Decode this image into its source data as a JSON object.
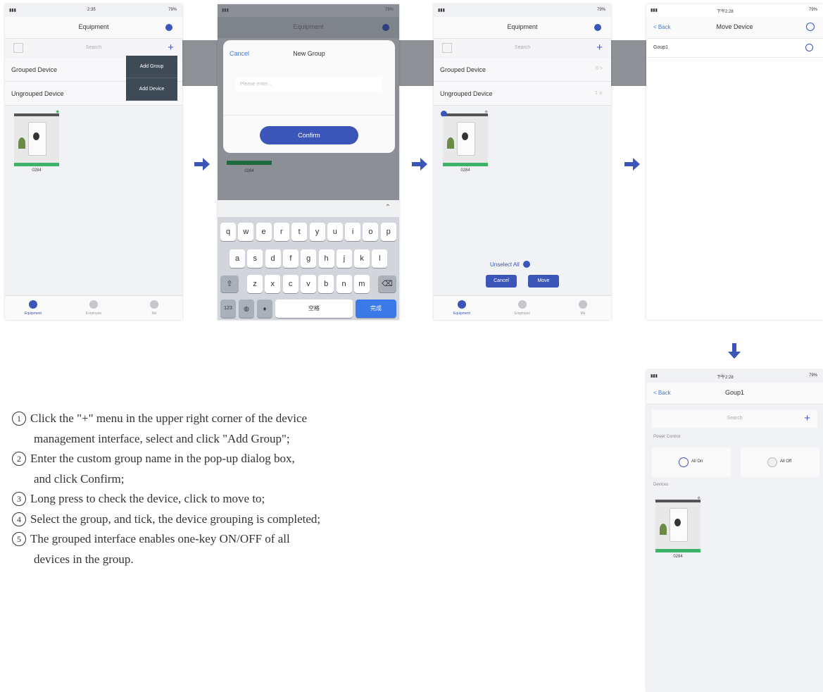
{
  "status": {
    "time1": "2:35",
    "time2": "下午2:28",
    "battery": "79%"
  },
  "screen1": {
    "title": "Equipment",
    "search_placeholder": "Search",
    "menu": [
      "Add Group",
      "Add Device"
    ],
    "rows": [
      {
        "label": "Grouped Device",
        "count": ""
      },
      {
        "label": "Ungrouped Device",
        "count": ""
      }
    ],
    "device_label": "0284",
    "tabs": [
      "Equipment",
      "Employee",
      "Me"
    ]
  },
  "screen2": {
    "title": "Equipment",
    "dialog_cancel": "Cancel",
    "dialog_title": "New Group",
    "input_placeholder": "Please enter...",
    "confirm": "Confirm",
    "device_label": "0284",
    "keyboard_row1": [
      "q",
      "w",
      "e",
      "r",
      "t",
      "y",
      "u",
      "i",
      "o",
      "p"
    ],
    "keyboard_row2": [
      "a",
      "s",
      "d",
      "f",
      "g",
      "h",
      "j",
      "k",
      "l"
    ],
    "keyboard_row3": [
      "z",
      "x",
      "c",
      "v",
      "b",
      "n",
      "m"
    ],
    "key_123": "123",
    "key_space": "空格",
    "key_done": "完成"
  },
  "screen3": {
    "title": "Equipment",
    "search_placeholder": "Search",
    "rows": [
      {
        "label": "Grouped Device",
        "count": "0 >"
      },
      {
        "label": "Ungrouped Device",
        "count": "1 ∨"
      }
    ],
    "device_label": "0284",
    "unselect_all": "Unselect All",
    "cancel": "Cancel",
    "move": "Move",
    "tabs": [
      "Equipment",
      "Employee",
      "Me"
    ]
  },
  "screen4": {
    "back": "< Back",
    "title": "Move Device",
    "group_item": "Goup1"
  },
  "screen5": {
    "back": "< Back",
    "title": "Goup1",
    "search_placeholder": "Search",
    "power_section": "Power Control",
    "all_on": "All On",
    "all_off": "All Off",
    "devices_section": "Devices",
    "device_label": "0284"
  },
  "instructions": [
    {
      "num": "1",
      "line1": "Click the \"+\" menu in the upper right corner of the device",
      "line2": "management interface, select and click \"Add Group\";"
    },
    {
      "num": "2",
      "line1": "Enter the custom group name in the pop-up dialog box,",
      "line2": "and click Confirm;"
    },
    {
      "num": "3",
      "line1": "Long press to check the device, click to move to;",
      "line2": ""
    },
    {
      "num": "4",
      "line1": "Select the group, and tick, the device grouping is completed;",
      "line2": ""
    },
    {
      "num": "5",
      "line1": "The grouped interface enables one-key ON/OFF of all",
      "line2": "devices in the group."
    }
  ],
  "colors": {
    "accent": "#3b56b8",
    "connector": "#8e9196",
    "device_bar": "#3db36a",
    "menu_bg": "#3f4a57"
  }
}
